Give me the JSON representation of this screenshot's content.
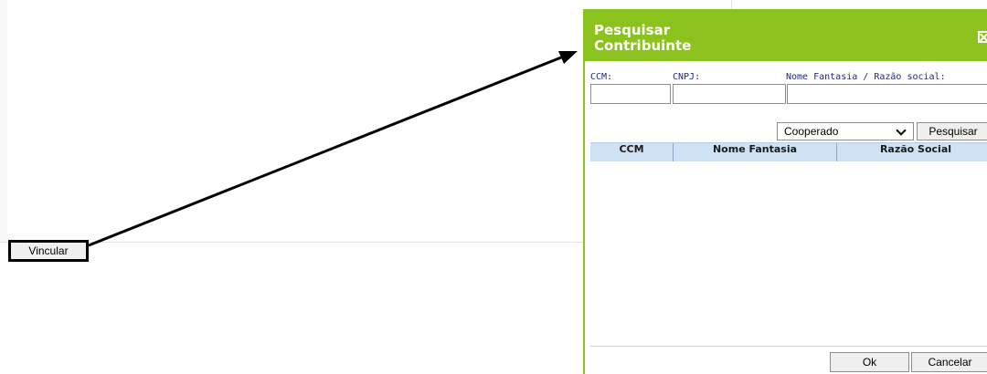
{
  "page": {
    "link_button_label": "Vincular"
  },
  "dialog": {
    "title_line1": "Pesquisar",
    "title_line2": "Contribuinte",
    "close_icon": "close-box-icon",
    "accent_color": "#8bc21d",
    "fields": {
      "ccm_label": "CCM:",
      "ccm_value": "",
      "cnpj_label": "CNPJ:",
      "cnpj_value": "",
      "nome_label": "Nome Fantasia / Razão social:",
      "nome_value": ""
    },
    "filter": {
      "selected": "Cooperado",
      "search_label": "Pesquisar"
    },
    "table": {
      "columns": [
        "CCM",
        "Nome Fantasia",
        "Razão Social"
      ],
      "rows": []
    },
    "ok_label": "Ok",
    "cancel_label": "Cancelar"
  }
}
